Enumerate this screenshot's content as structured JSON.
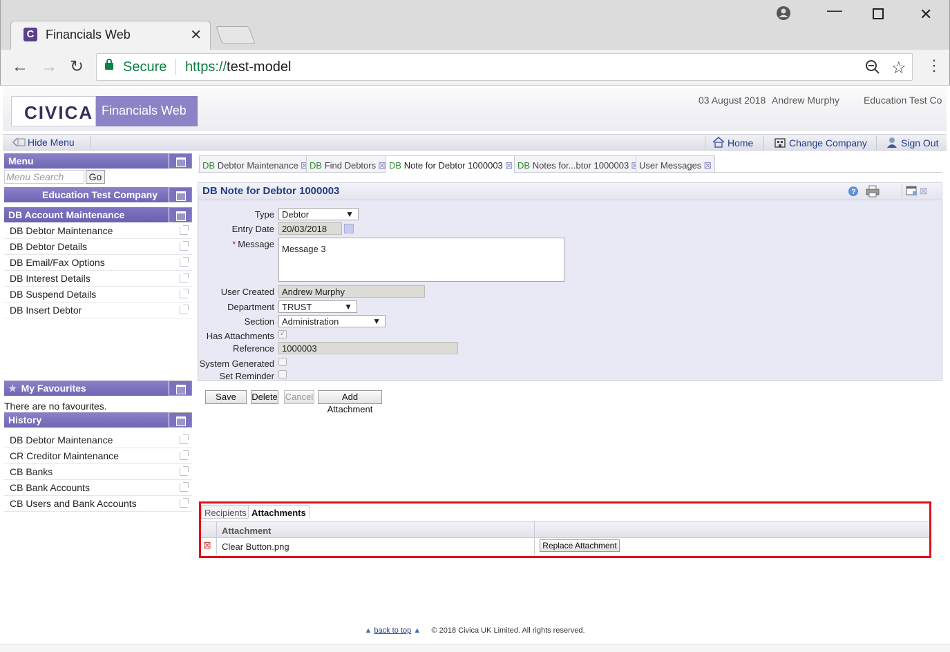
{
  "browser": {
    "tab_title": "Financials Web",
    "tab_favicon": "C",
    "secure_label": "Secure",
    "url_scheme": "https://",
    "url_host": "test-model"
  },
  "header": {
    "logo": "CIVICA",
    "product": "Financials Web",
    "date": "03 August 2018",
    "user": "Andrew Murphy",
    "company": "Education Test Co"
  },
  "menubar": {
    "hide_menu": "Hide Menu",
    "home": "Home",
    "change_company": "Change Company",
    "sign_out": "Sign Out"
  },
  "menu": {
    "title": "Menu",
    "search_placeholder": "Menu Search",
    "go": "Go",
    "company_title": "Education Test Company",
    "section_title": "DB Account Maintenance",
    "items": [
      {
        "label": "DB Debtor Maintenance"
      },
      {
        "label": "DB Debtor Details"
      },
      {
        "label": "DB Email/Fax Options"
      },
      {
        "label": "DB Interest Details"
      },
      {
        "label": "DB Suspend Details"
      },
      {
        "label": "DB Insert Debtor"
      }
    ]
  },
  "favourites": {
    "title": "My Favourites",
    "empty_text": "There are no favourites."
  },
  "history": {
    "title": "History",
    "items": [
      {
        "label": "DB Debtor Maintenance"
      },
      {
        "label": "CR Creditor Maintenance"
      },
      {
        "label": "CB Banks"
      },
      {
        "label": "CB Bank Accounts"
      },
      {
        "label": "CB Users and Bank Accounts"
      }
    ]
  },
  "page_tabs": [
    {
      "prefix": "DB",
      "label": "Debtor Maintenance"
    },
    {
      "prefix": "DB",
      "label": "Find Debtors"
    },
    {
      "prefix": "DB",
      "label": "Note for Debtor 1000003"
    },
    {
      "prefix": "DB",
      "label": "Notes for...btor 1000003"
    },
    {
      "prefix": "",
      "label": "User Messages"
    }
  ],
  "panel": {
    "title": "DB Note for Debtor 1000003"
  },
  "form": {
    "type_label": "Type",
    "type_value": "Debtor",
    "entry_date_label": "Entry Date",
    "entry_date_value": "20/03/2018",
    "message_label": "Message",
    "message_value": "Message 3",
    "user_created_label": "User Created",
    "user_created_value": "Andrew Murphy",
    "department_label": "Department",
    "department_value": "TRUST",
    "section_label": "Section",
    "section_value": "Administration",
    "has_attachments_label": "Has Attachments",
    "has_attachments_checked": true,
    "reference_label": "Reference",
    "reference_value": "1000003",
    "system_generated_label": "System Generated",
    "set_reminder_label": "Set Reminder"
  },
  "actions": {
    "save": "Save",
    "delete": "Delete",
    "cancel": "Cancel",
    "add_attachment": "Add Attachment"
  },
  "attachments": {
    "tabs": [
      "Recipients",
      "Attachments"
    ],
    "column_attachment": "Attachment",
    "rows": [
      {
        "file": "Clear Button.png",
        "action": "Replace Attachment"
      }
    ]
  },
  "footer": {
    "back_to_top": "back to top",
    "copyright": "© 2018 Civica UK Limited. All rights reserved."
  }
}
